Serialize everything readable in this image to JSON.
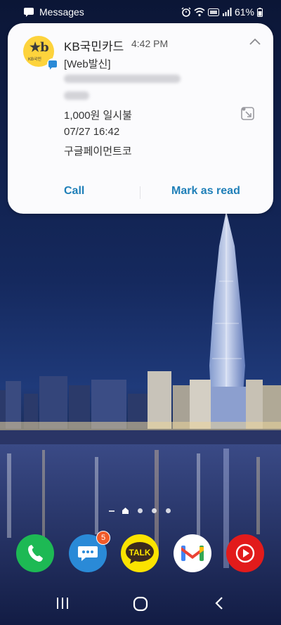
{
  "status_bar": {
    "app_name": "Messages",
    "battery_percent": "61%"
  },
  "notification": {
    "app_label": "KB국민",
    "sender": "KB국민카드",
    "time": "4:42 PM",
    "lines": [
      "[Web발신]",
      "1,000원 일시불",
      "07/27 16:42",
      "구글페이먼트코"
    ],
    "actions": {
      "call": "Call",
      "mark_read": "Mark as read"
    }
  },
  "dock": {
    "messages_badge": "5",
    "kakao_label": "TALK"
  },
  "colors": {
    "accent": "#1f7fb8",
    "kb_yellow": "#fdd33c",
    "phone_green": "#1db954",
    "messages_blue": "#2a8ad7",
    "kakao_yellow": "#fbe300",
    "youtube_red": "#e21b1b"
  },
  "pager": {
    "pages": 4,
    "current": 1
  }
}
